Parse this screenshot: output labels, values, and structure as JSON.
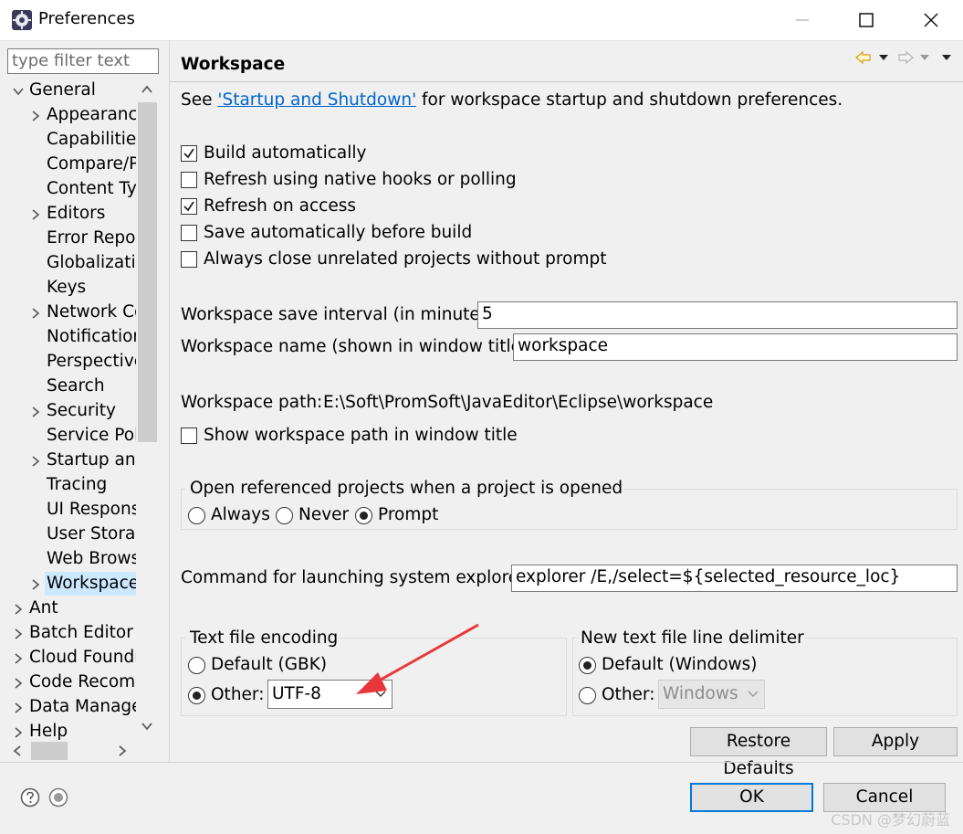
{
  "window": {
    "title": "Preferences",
    "icon": "eclipse-icon"
  },
  "sidebar": {
    "filter_placeholder": "type filter text",
    "items": [
      {
        "label": "General",
        "expanded": true
      },
      {
        "label": "Appearance"
      },
      {
        "label": "Capabilities"
      },
      {
        "label": "Compare/P"
      },
      {
        "label": "Content Typ"
      },
      {
        "label": "Editors"
      },
      {
        "label": "Error Repor"
      },
      {
        "label": "Globalizatio"
      },
      {
        "label": "Keys"
      },
      {
        "label": "Network Co"
      },
      {
        "label": "Notification"
      },
      {
        "label": "Perspective"
      },
      {
        "label": "Search"
      },
      {
        "label": "Security"
      },
      {
        "label": "Service Poli"
      },
      {
        "label": "Startup and"
      },
      {
        "label": "Tracing"
      },
      {
        "label": "UI Responsi"
      },
      {
        "label": "User Storag"
      },
      {
        "label": "Web Brows"
      },
      {
        "label": "Workspace",
        "selected": true
      },
      {
        "label": "Ant"
      },
      {
        "label": "Batch Editor"
      },
      {
        "label": "Cloud Foundr"
      },
      {
        "label": "Code Recomr"
      },
      {
        "label": "Data Manage"
      },
      {
        "label": "Help"
      }
    ]
  },
  "page": {
    "title": "Workspace",
    "intro_before": "See ",
    "intro_link": "'Startup and Shutdown'",
    "intro_after": " for workspace startup and shutdown preferences.",
    "checkboxes": [
      {
        "label": "Build automatically",
        "checked": true
      },
      {
        "label": "Refresh using native hooks or polling",
        "checked": false
      },
      {
        "label": "Refresh on access",
        "checked": true
      },
      {
        "label": "Save automatically before build",
        "checked": false
      },
      {
        "label": "Always close unrelated projects without prompt",
        "checked": false
      }
    ],
    "save_interval_label": "Workspace save interval (in minutes):",
    "save_interval_value": "5",
    "workspace_name_label": "Workspace name (shown in window title):",
    "workspace_name_value": "workspace",
    "workspace_path_label": "Workspace path:",
    "workspace_path_value": "E:\\Soft\\PromSoft\\JavaEditor\\Eclipse\\workspace",
    "show_path_label": "Show workspace path in window title",
    "open_ref_group": {
      "title": "Open referenced projects when a project is opened",
      "options": [
        "Always",
        "Never",
        "Prompt"
      ],
      "selected": "Prompt"
    },
    "explorer_label": "Command for launching system explorer:",
    "explorer_value": "explorer /E,/select=${selected_resource_loc}",
    "encoding_group": {
      "title": "Text file encoding",
      "default_label": "Default (GBK)",
      "other_label": "Other:",
      "other_value": "UTF-8",
      "selected": "Other"
    },
    "delimiter_group": {
      "title": "New text file line delimiter",
      "default_label": "Default (Windows)",
      "other_label": "Other:",
      "other_value": "Windows",
      "selected": "Default"
    },
    "restore_defaults": "Restore Defaults",
    "apply": "Apply"
  },
  "footer": {
    "ok": "OK",
    "cancel": "Cancel",
    "watermark": "CSDN @梦幻蔚蓝"
  },
  "colors": {
    "link": "#0066cc",
    "selection": "#cce8ff",
    "annotation_arrow": "#e8373a",
    "default_button_border": "#0078d7"
  }
}
